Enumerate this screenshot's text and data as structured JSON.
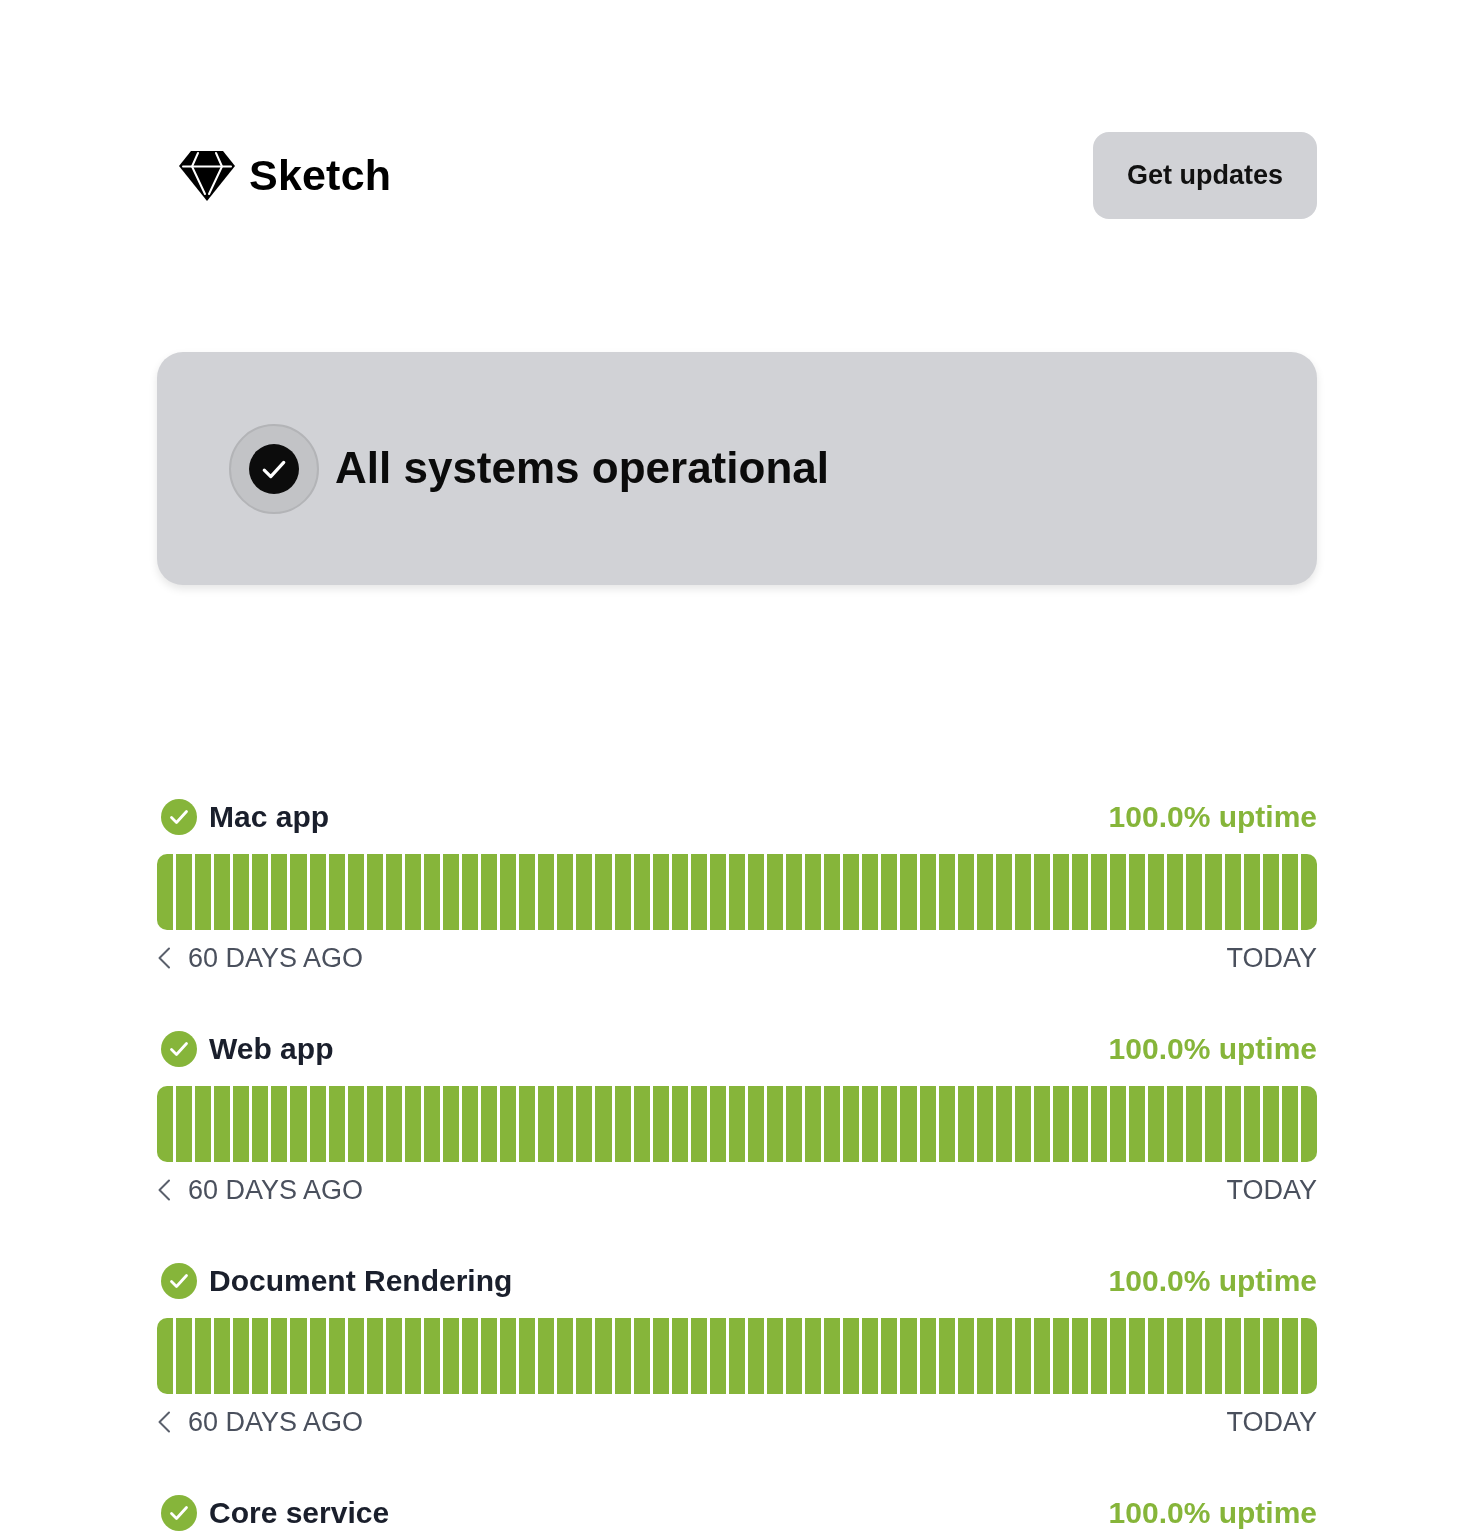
{
  "header": {
    "logo": "Sketch",
    "button": "Get updates"
  },
  "status": {
    "title": "All systems operational",
    "operational": true
  },
  "components": [
    {
      "name": "Mac app",
      "operational": true,
      "uptime": "100.0% uptime",
      "range_start": "60 DAYS AGO",
      "range_end": "TODAY",
      "days": [
        {
          "operational": true
        },
        {
          "operational": true
        },
        {
          "operational": true
        },
        {
          "operational": true
        },
        {
          "operational": true
        },
        {
          "operational": true
        },
        {
          "operational": true
        },
        {
          "operational": true
        },
        {
          "operational": true
        },
        {
          "operational": true
        },
        {
          "operational": true
        },
        {
          "operational": true
        },
        {
          "operational": true
        },
        {
          "operational": true
        },
        {
          "operational": true
        },
        {
          "operational": true
        },
        {
          "operational": true
        },
        {
          "operational": true
        },
        {
          "operational": true
        },
        {
          "operational": true
        },
        {
          "operational": true
        },
        {
          "operational": true
        },
        {
          "operational": true
        },
        {
          "operational": true
        },
        {
          "operational": true
        },
        {
          "operational": true
        },
        {
          "operational": true
        },
        {
          "operational": true
        },
        {
          "operational": true
        },
        {
          "operational": true
        },
        {
          "operational": true
        },
        {
          "operational": true
        },
        {
          "operational": true
        },
        {
          "operational": true
        },
        {
          "operational": true
        },
        {
          "operational": true
        },
        {
          "operational": true
        },
        {
          "operational": true
        },
        {
          "operational": true
        },
        {
          "operational": true
        },
        {
          "operational": true
        },
        {
          "operational": true
        },
        {
          "operational": true
        },
        {
          "operational": true
        },
        {
          "operational": true
        },
        {
          "operational": true
        },
        {
          "operational": true
        },
        {
          "operational": true
        },
        {
          "operational": true
        },
        {
          "operational": true
        },
        {
          "operational": true
        },
        {
          "operational": true
        },
        {
          "operational": true
        },
        {
          "operational": true
        },
        {
          "operational": true
        },
        {
          "operational": true
        },
        {
          "operational": true
        },
        {
          "operational": true
        },
        {
          "operational": true
        },
        {
          "operational": true
        },
        {
          "operational": true
        }
      ]
    },
    {
      "name": "Web app",
      "operational": true,
      "uptime": "100.0% uptime",
      "range_start": "60 DAYS AGO",
      "range_end": "TODAY",
      "days": [
        {
          "operational": true
        },
        {
          "operational": true
        },
        {
          "operational": true
        },
        {
          "operational": true
        },
        {
          "operational": true
        },
        {
          "operational": true
        },
        {
          "operational": true
        },
        {
          "operational": true
        },
        {
          "operational": true
        },
        {
          "operational": true
        },
        {
          "operational": true
        },
        {
          "operational": true
        },
        {
          "operational": true
        },
        {
          "operational": true
        },
        {
          "operational": true
        },
        {
          "operational": true
        },
        {
          "operational": true
        },
        {
          "operational": true
        },
        {
          "operational": true
        },
        {
          "operational": true
        },
        {
          "operational": true
        },
        {
          "operational": true
        },
        {
          "operational": true
        },
        {
          "operational": true
        },
        {
          "operational": true
        },
        {
          "operational": true
        },
        {
          "operational": true
        },
        {
          "operational": true
        },
        {
          "operational": true
        },
        {
          "operational": true
        },
        {
          "operational": true
        },
        {
          "operational": true
        },
        {
          "operational": true
        },
        {
          "operational": true
        },
        {
          "operational": true
        },
        {
          "operational": true
        },
        {
          "operational": true
        },
        {
          "operational": true
        },
        {
          "operational": true
        },
        {
          "operational": true
        },
        {
          "operational": true
        },
        {
          "operational": true
        },
        {
          "operational": true
        },
        {
          "operational": true
        },
        {
          "operational": true
        },
        {
          "operational": true
        },
        {
          "operational": true
        },
        {
          "operational": true
        },
        {
          "operational": true
        },
        {
          "operational": true
        },
        {
          "operational": true
        },
        {
          "operational": true
        },
        {
          "operational": true
        },
        {
          "operational": true
        },
        {
          "operational": true
        },
        {
          "operational": true
        },
        {
          "operational": true
        },
        {
          "operational": true
        },
        {
          "operational": true
        },
        {
          "operational": true
        },
        {
          "operational": true
        }
      ]
    },
    {
      "name": "Document Rendering",
      "operational": true,
      "uptime": "100.0% uptime",
      "range_start": "60 DAYS AGO",
      "range_end": "TODAY",
      "days": [
        {
          "operational": true
        },
        {
          "operational": true
        },
        {
          "operational": true
        },
        {
          "operational": true
        },
        {
          "operational": true
        },
        {
          "operational": true
        },
        {
          "operational": true
        },
        {
          "operational": true
        },
        {
          "operational": true
        },
        {
          "operational": true
        },
        {
          "operational": true
        },
        {
          "operational": true
        },
        {
          "operational": true
        },
        {
          "operational": true
        },
        {
          "operational": true
        },
        {
          "operational": true
        },
        {
          "operational": true
        },
        {
          "operational": true
        },
        {
          "operational": true
        },
        {
          "operational": true
        },
        {
          "operational": true
        },
        {
          "operational": true
        },
        {
          "operational": true
        },
        {
          "operational": true
        },
        {
          "operational": true
        },
        {
          "operational": true
        },
        {
          "operational": true
        },
        {
          "operational": true
        },
        {
          "operational": true
        },
        {
          "operational": true
        },
        {
          "operational": true
        },
        {
          "operational": true
        },
        {
          "operational": true
        },
        {
          "operational": true
        },
        {
          "operational": true
        },
        {
          "operational": true
        },
        {
          "operational": true
        },
        {
          "operational": true
        },
        {
          "operational": true
        },
        {
          "operational": true
        },
        {
          "operational": true
        },
        {
          "operational": true
        },
        {
          "operational": true
        },
        {
          "operational": true
        },
        {
          "operational": true
        },
        {
          "operational": true
        },
        {
          "operational": true
        },
        {
          "operational": true
        },
        {
          "operational": true
        },
        {
          "operational": true
        },
        {
          "operational": true
        },
        {
          "operational": true
        },
        {
          "operational": true
        },
        {
          "operational": true
        },
        {
          "operational": true
        },
        {
          "operational": true
        },
        {
          "operational": true
        },
        {
          "operational": true
        },
        {
          "operational": true
        },
        {
          "operational": true
        },
        {
          "operational": true
        }
      ]
    },
    {
      "name": "Core service",
      "operational": true,
      "uptime": "100.0% uptime"
    }
  ]
}
